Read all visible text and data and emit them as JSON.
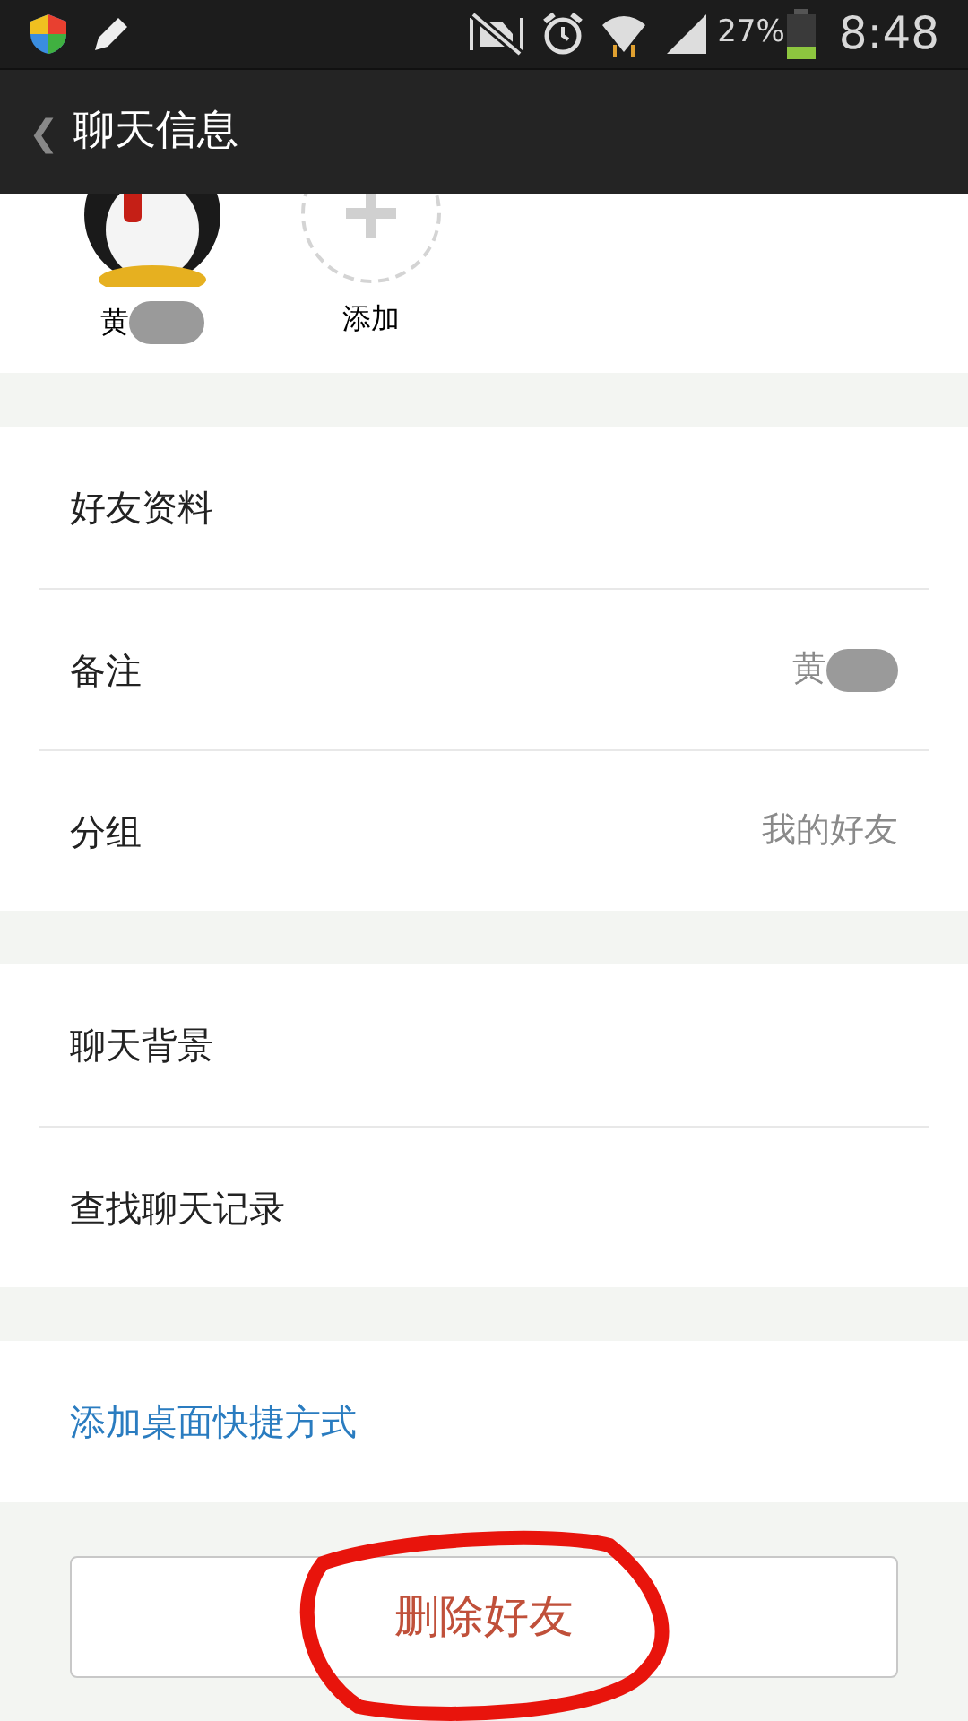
{
  "status_bar": {
    "battery": "27%",
    "time": "8:48"
  },
  "header": {
    "back": "❮",
    "title": "聊天信息"
  },
  "members": [
    {
      "kind": "avatar",
      "name": "黄"
    },
    {
      "kind": "add",
      "name": "添加"
    }
  ],
  "sections": [
    {
      "rows": [
        {
          "label": "好友资料"
        },
        {
          "label": "备注",
          "value": "黄",
          "redacted": true
        },
        {
          "label": "分组",
          "value": "我的好友"
        }
      ]
    },
    {
      "rows": [
        {
          "label": "聊天背景"
        },
        {
          "label": "查找聊天记录"
        }
      ]
    },
    {
      "rows": [
        {
          "label": "添加桌面快捷方式",
          "kind": "link"
        }
      ]
    }
  ],
  "delete_button": {
    "label": "删除好友",
    "circled": true
  }
}
